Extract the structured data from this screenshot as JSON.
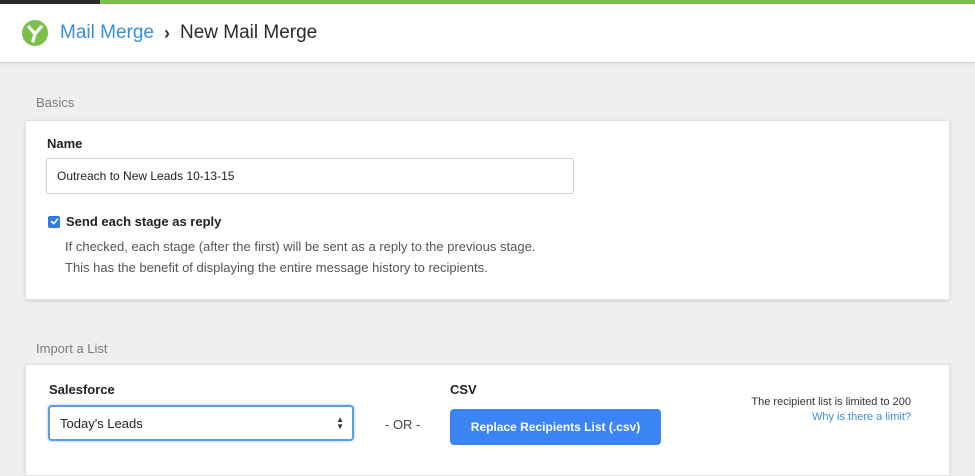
{
  "colors": {
    "accent_green": "#7cc04b",
    "link_blue": "#3a8fd6",
    "button_blue": "#3a84f5"
  },
  "header": {
    "logo_icon": "yesware-y-logo-icon",
    "breadcrumb_parent": "Mail Merge",
    "breadcrumb_separator_icon": "chevron-right-icon",
    "breadcrumb_current": "New Mail Merge"
  },
  "basics": {
    "section_label": "Basics",
    "name_label": "Name",
    "name_value": "Outreach to New Leads 10-13-15",
    "reply_checkbox_checked": true,
    "reply_checkbox_label": "Send each stage as reply",
    "help_line1": "If checked, each stage (after the first) will be sent as a reply to the previous stage.",
    "help_line2": "This has the benefit of displaying the entire message history to recipients."
  },
  "import": {
    "section_label": "Import a List",
    "salesforce_label": "Salesforce",
    "salesforce_selected": "Today's Leads",
    "or_text": "- OR -",
    "csv_label": "CSV",
    "csv_button": "Replace Recipients List (.csv)",
    "limit_text": "The recipient list is limited to 200",
    "limit_link": "Why is there a limit?"
  }
}
